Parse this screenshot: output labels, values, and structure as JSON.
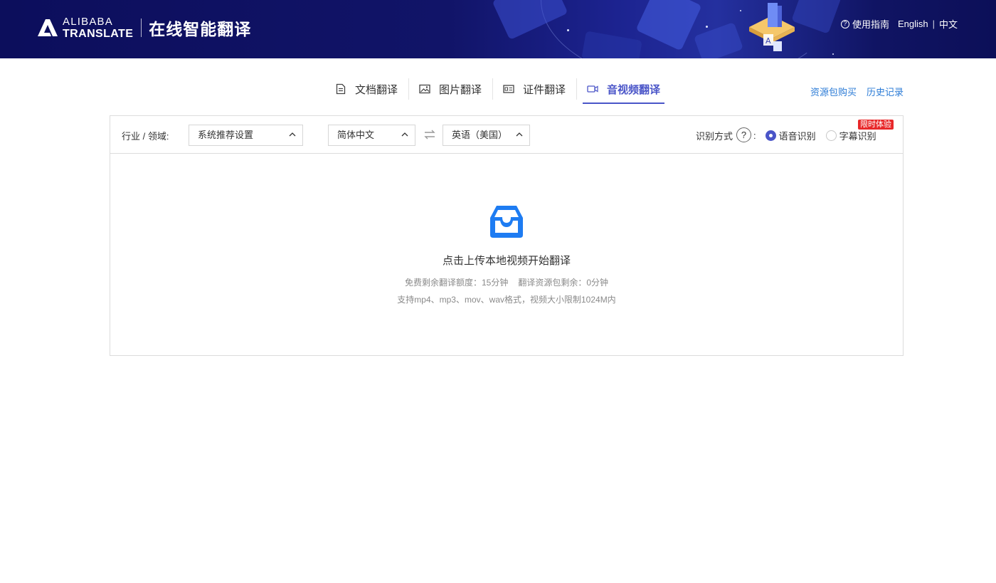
{
  "header": {
    "logo_top": "ALIBABA",
    "logo_bottom": "TRANSLATE",
    "product_title": "在线智能翻译",
    "guide_label": "使用指南",
    "lang_en": "English",
    "lang_separator": "|",
    "lang_cn": "中文",
    "icons": [
      "help-circle-icon"
    ]
  },
  "tabs": [
    {
      "label": "文档翻译",
      "icon": "document-icon",
      "active": false
    },
    {
      "label": "图片翻译",
      "icon": "image-icon",
      "active": false
    },
    {
      "label": "证件翻译",
      "icon": "id-card-icon",
      "active": false
    },
    {
      "label": "音视频翻译",
      "icon": "video-icon",
      "active": true
    }
  ],
  "top_links": {
    "purchase": "资源包购买",
    "history": "历史记录"
  },
  "toolbar": {
    "domain_label": "行业 / 领域:",
    "domain_value": "系统推荐设置",
    "source_lang": "简体中文",
    "target_lang": "英语（美国）",
    "recognition_label": "识别方式",
    "help_mark": "?",
    "colon": ":",
    "options": [
      {
        "label": "语音识别",
        "checked": true
      },
      {
        "label": "字幕识别",
        "checked": false
      }
    ],
    "badge": "限时体验"
  },
  "upload": {
    "title": "点击上传本地视频开始翻译",
    "free_quota": "免费剩余翻译额度：15分钟",
    "package_quota": "翻译资源包剩余：0分钟",
    "formats": "支持mp4、mp3、mov、wav格式，视频大小限制1024M内"
  },
  "colors": {
    "header_bg": "#0c0e5c",
    "accent": "#4a55c8",
    "link": "#2b7bd6",
    "upload_icon": "#1e7cf2",
    "badge": "#e8282a"
  }
}
